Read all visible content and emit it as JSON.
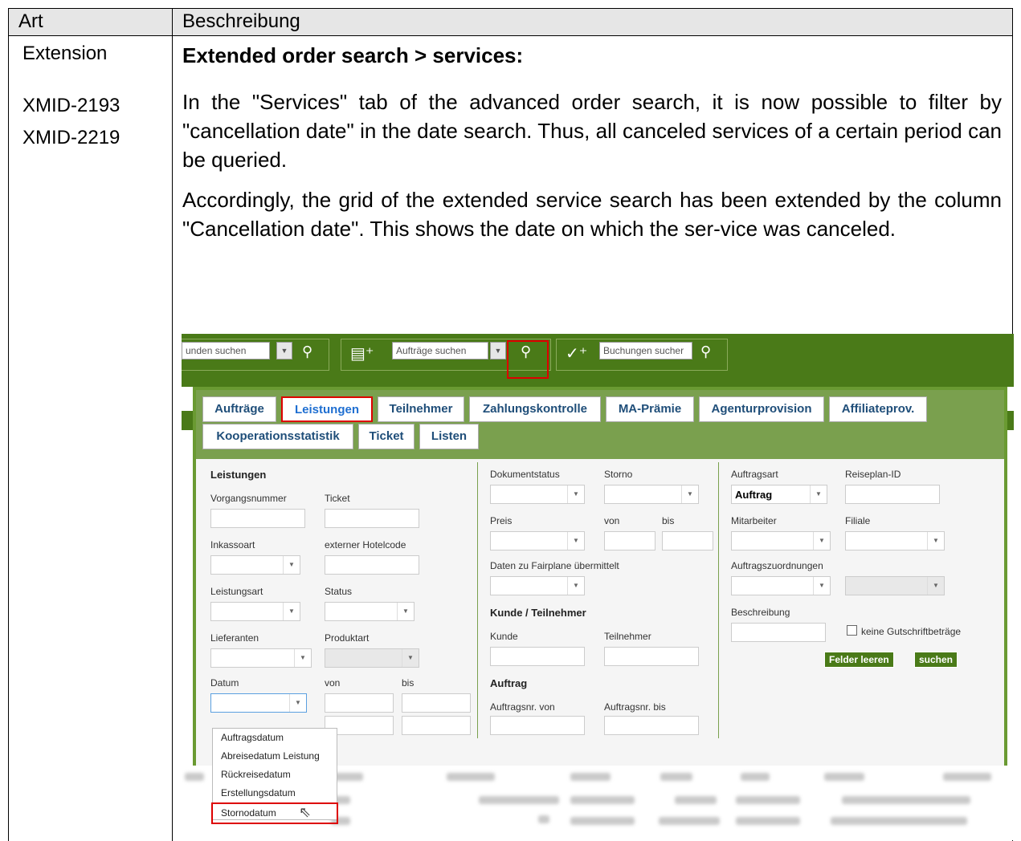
{
  "table": {
    "header_art": "Art",
    "header_beschreibung": "Beschreibung",
    "type": "Extension",
    "ids": [
      "XMID-2193",
      "XMID-2219"
    ],
    "heading": "Extended order search > services:",
    "paragraph1": "In the \"Services\" tab of the advanced order search, it is now possible to filter by \"cancellation date\" in the date search. Thus, all canceled services of a certain period can be queried.",
    "paragraph2": "Accordingly, the grid of the extended service search has been extended by the column \"Cancellation date\". This shows the date on which the ser-vice was canceled."
  },
  "screenshot": {
    "topbar": {
      "customer_search": "unden suchen",
      "order_search": "Aufträge suchen",
      "booking_search": "Buchungen sucher"
    },
    "tabs_row1": [
      "Aufträge",
      "Leistungen",
      "Teilnehmer",
      "Zahlungskontrolle",
      "MA-Prämie",
      "Agenturprovision",
      "Affiliateprov."
    ],
    "tabs_row2": [
      "Kooperationsstatistik",
      "Ticket",
      "Listen"
    ],
    "col1": {
      "section": "Leistungen",
      "vorgangsnummer": "Vorgangsnummer",
      "ticket": "Ticket",
      "inkassoart": "Inkassoart",
      "externer_hotelcode": "externer Hotelcode",
      "leistungsart": "Leistungsart",
      "status": "Status",
      "lieferanten": "Lieferanten",
      "produktart": "Produktart",
      "datum": "Datum",
      "von": "von",
      "bis": "bis"
    },
    "col2": {
      "dokumentstatus": "Dokumentstatus",
      "storno": "Storno",
      "preis": "Preis",
      "von": "von",
      "bis": "bis",
      "fairplane": "Daten zu Fairplane übermittelt",
      "kunde_teilnehmer": "Kunde / Teilnehmer",
      "kunde": "Kunde",
      "teilnehmer": "Teilnehmer",
      "auftrag": "Auftrag",
      "auftragsnr_von": "Auftragsnr. von",
      "auftragsnr_bis": "Auftragsnr. bis"
    },
    "col3": {
      "auftragsart": "Auftragsart",
      "reiseplan_id": "Reiseplan-ID",
      "auftragsart_value": "Auftrag",
      "mitarbeiter": "Mitarbeiter",
      "filiale": "Filiale",
      "auftragszuordnungen": "Auftragszuordnungen",
      "beschreibung": "Beschreibung",
      "keine_gutschrift": "keine Gutschriftbeträge",
      "felder_leeren": "Felder leeren",
      "suchen": "suchen"
    },
    "date_menu": [
      "Auftragsdatum",
      "Abreisedatum Leistung",
      "Rückreisedatum",
      "Erstellungsdatum",
      "Stornodatum"
    ]
  }
}
